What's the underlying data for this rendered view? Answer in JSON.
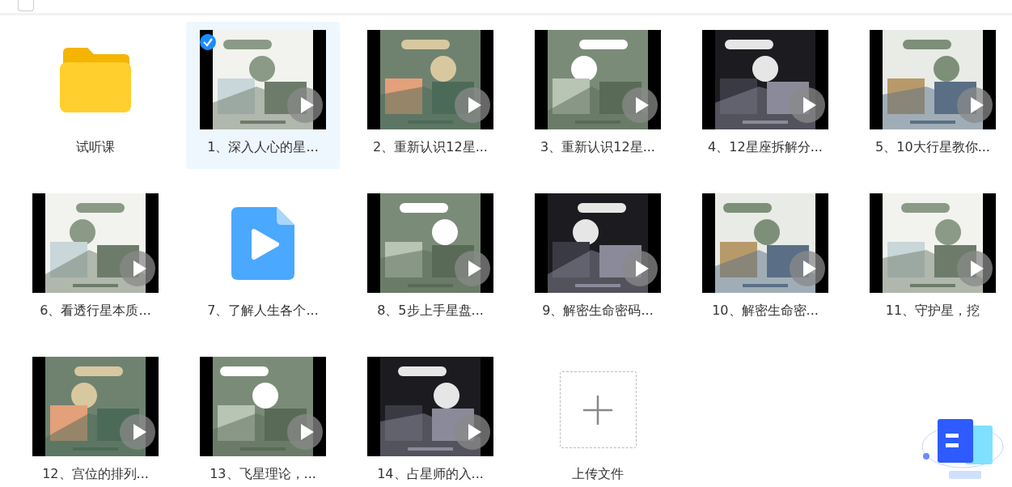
{
  "header": {
    "checked": false
  },
  "items": [
    {
      "kind": "folder",
      "name": "试听课",
      "selected": false
    },
    {
      "kind": "video",
      "name": "1、深入人心的星...",
      "selected": true
    },
    {
      "kind": "video",
      "name": "2、重新认识12星...",
      "selected": false
    },
    {
      "kind": "video",
      "name": "3、重新认识12星...",
      "selected": false
    },
    {
      "kind": "video",
      "name": "4、12星座拆解分...",
      "selected": false
    },
    {
      "kind": "video",
      "name": "5、10大行星教你...",
      "selected": false
    },
    {
      "kind": "video",
      "name": "6、看透行星本质...",
      "selected": false
    },
    {
      "kind": "video-file",
      "name": "7、了解人生各个...",
      "selected": false
    },
    {
      "kind": "video",
      "name": "8、5步上手星盘...",
      "selected": false
    },
    {
      "kind": "video",
      "name": "9、解密生命密码...",
      "selected": false
    },
    {
      "kind": "video",
      "name": "10、解密生命密...",
      "selected": false
    },
    {
      "kind": "video",
      "name": "11、守护星，挖",
      "selected": false
    },
    {
      "kind": "video",
      "name": "12、宫位的排列...",
      "selected": false
    },
    {
      "kind": "video",
      "name": "13、飞星理论，...",
      "selected": false
    },
    {
      "kind": "video",
      "name": "14、占星师的入...",
      "selected": false
    },
    {
      "kind": "upload",
      "name": "上传文件",
      "selected": false
    }
  ]
}
